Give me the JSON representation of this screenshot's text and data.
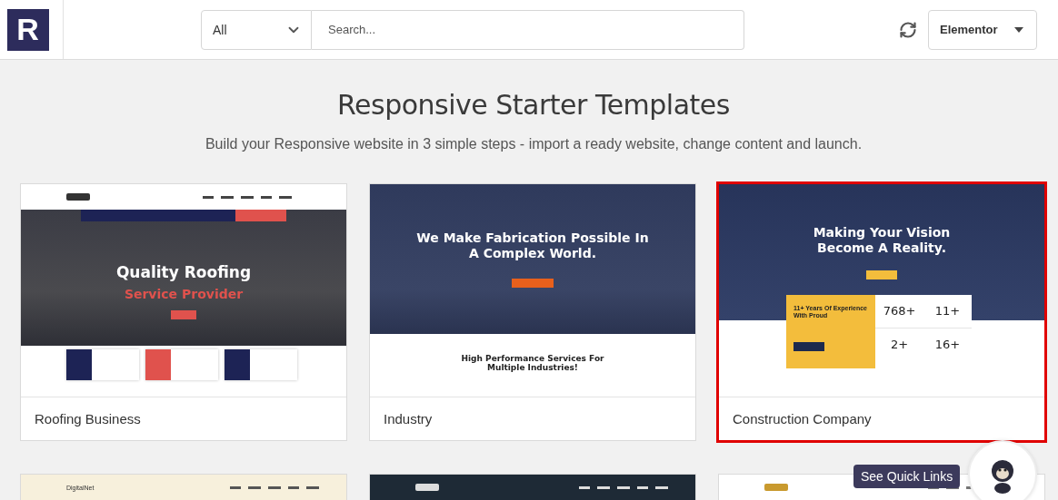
{
  "header": {
    "logo": "R",
    "category_filter": {
      "value": "All"
    },
    "search": {
      "placeholder": "Search..."
    },
    "builder_select": {
      "value": "Elementor"
    }
  },
  "page": {
    "title": "Responsive Starter Templates",
    "subtitle": "Build your Responsive website in 3 simple steps - import a ready website, change content and launch."
  },
  "templates": [
    {
      "kind": "roofing",
      "name": "Roofing Business",
      "selected": false,
      "preview": {
        "headline": "Quality Roofing",
        "subheadline": "Service Provider"
      }
    },
    {
      "kind": "industry",
      "name": "Industry",
      "selected": false,
      "preview": {
        "headline": "We Make Fabrication Possible In A Complex World.",
        "section_title": "High Performance Services For Multiple Industries!"
      }
    },
    {
      "kind": "construction",
      "name": "Construction Company",
      "selected": true,
      "preview": {
        "headline": "Making Your Vision Become A Reality.",
        "feature_title": "11+ Years Of Experience With Proud",
        "stats": [
          "768+",
          "11+",
          "2+",
          "16+"
        ]
      }
    },
    {
      "kind": "digital",
      "selected": false,
      "preview": {
        "brand": "DigitalNet"
      }
    },
    {
      "kind": "dark",
      "selected": false
    },
    {
      "kind": "warm",
      "selected": false
    }
  ],
  "quick_links": {
    "label": "See Quick Links"
  }
}
